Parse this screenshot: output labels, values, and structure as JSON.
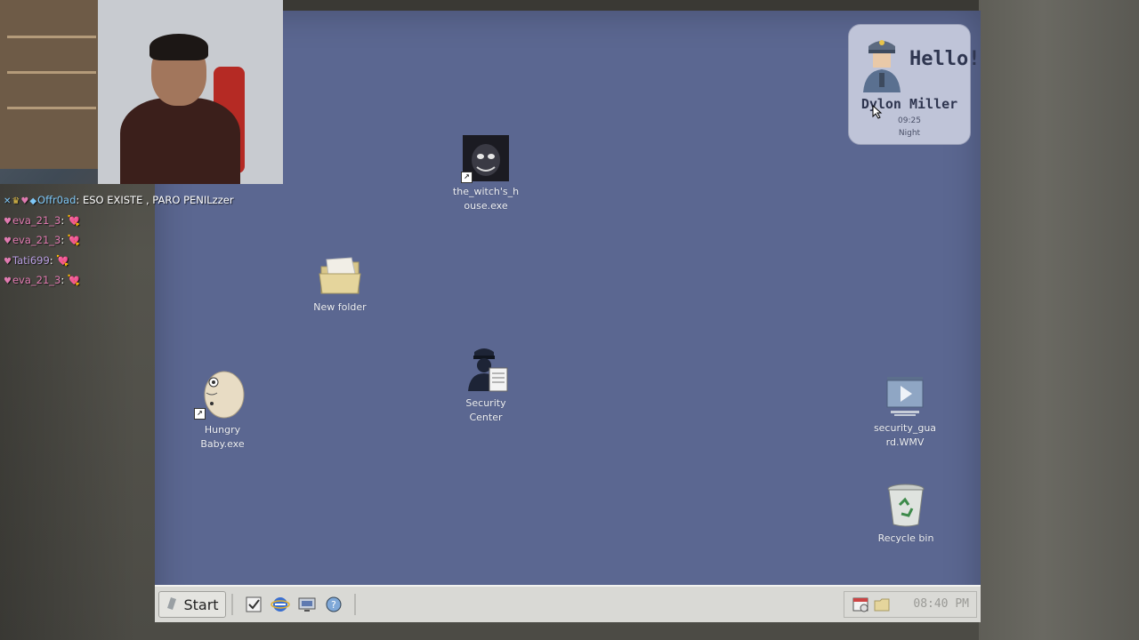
{
  "desktop": {
    "icons": [
      {
        "label": "the_witch's_h\nouse.exe",
        "icon": "witch-face-icon"
      },
      {
        "label": "New folder",
        "icon": "folder-icon"
      },
      {
        "label": "Security\nCenter",
        "icon": "security-guard-icon"
      },
      {
        "label": "Hungry\nBaby.exe",
        "icon": "baby-icon"
      },
      {
        "label": "security_gua\nrd.WMV",
        "icon": "video-file-icon"
      },
      {
        "label": "Recycle bin",
        "icon": "recycle-bin-icon"
      }
    ]
  },
  "welcome": {
    "greeting": "Hello!",
    "user_name": "Dylon Miller",
    "time": "09:25",
    "period": "Night",
    "avatar_icon": "guard-avatar-icon"
  },
  "taskbar": {
    "start_label": "Start",
    "quick_launch": [
      "notepad-icon",
      "internet-explorer-icon",
      "computer-icon",
      "help-icon"
    ],
    "tray_icons": [
      "calendar-icon",
      "folder-tray-icon"
    ],
    "clock": "08:40 PM"
  },
  "chat": {
    "messages": [
      {
        "user": "Offr0ad",
        "text": "ESO EXISTE , PARO PENILzzer",
        "color": "#7fc8f8"
      },
      {
        "user": "eva_21_3",
        "text": "💘",
        "color": "#e07ab0"
      },
      {
        "user": "eva_21_3",
        "text": "💘",
        "color": "#e07ab0"
      },
      {
        "user": "Tati699",
        "text": "💘",
        "color": "#b79de0"
      },
      {
        "user": "eva_21_3",
        "text": "💘",
        "color": "#e07ab0"
      }
    ]
  },
  "colors": {
    "desktop_bg": "#5b6791",
    "taskbar_bg": "#d9d9d5",
    "card_bg": "#bfc4d8"
  }
}
